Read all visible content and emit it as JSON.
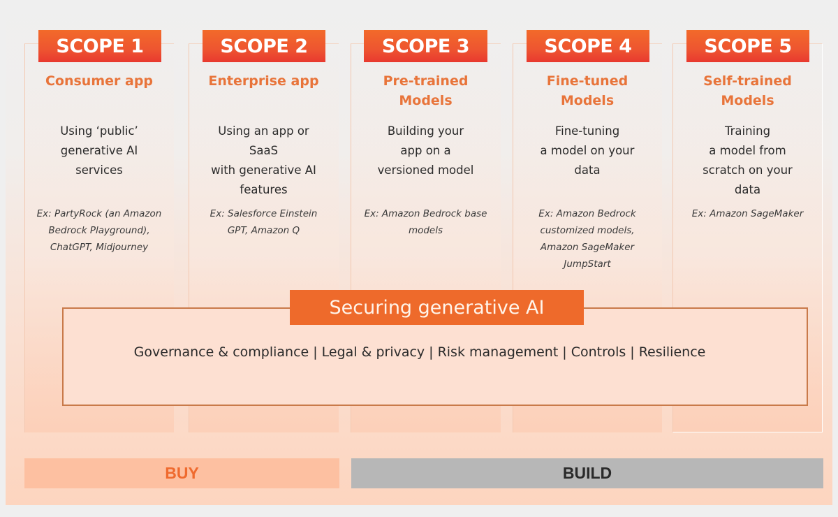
{
  "scopes": [
    {
      "badge": "SCOPE 1",
      "title": "Consumer app",
      "description": "Using ‘public’\ngenerative AI\nservices",
      "example": "Ex: PartyRock (an Amazon\nBedrock Playground),\nChatGPT, Midjourney"
    },
    {
      "badge": "SCOPE 2",
      "title": "Enterprise app",
      "description": "Using an app or\nSaaS\nwith generative AI\nfeatures",
      "example": "Ex: Salesforce Einstein\nGPT, Amazon Q"
    },
    {
      "badge": "SCOPE 3",
      "title": "Pre-trained\nModels",
      "description": "Building your\napp on a\nversioned model",
      "example": "Ex: Amazon Bedrock base\nmodels"
    },
    {
      "badge": "SCOPE 4",
      "title": "Fine-tuned\nModels",
      "description": "Fine-tuning\na model on your\ndata",
      "example": "Ex: Amazon Bedrock\ncustomized models,\nAmazon SageMaker\nJumpStart"
    },
    {
      "badge": "SCOPE 5",
      "title": "Self-trained\nModels",
      "description": "Training\na model from\nscratch on your\ndata",
      "example": "Ex: Amazon SageMaker"
    }
  ],
  "securing": {
    "label": "Securing generative AI",
    "items": [
      "Governance & compliance",
      "Legal & privacy",
      "Risk management",
      "Controls",
      "Resilience"
    ],
    "separator": "|"
  },
  "footer": {
    "buy_label": "BUY",
    "build_label": "BUILD"
  },
  "colors": {
    "badge_orange": "#ee5530",
    "title_orange": "#e8743a",
    "buy_bg": "#fdc0a1",
    "build_bg": "#b7b7b7"
  }
}
